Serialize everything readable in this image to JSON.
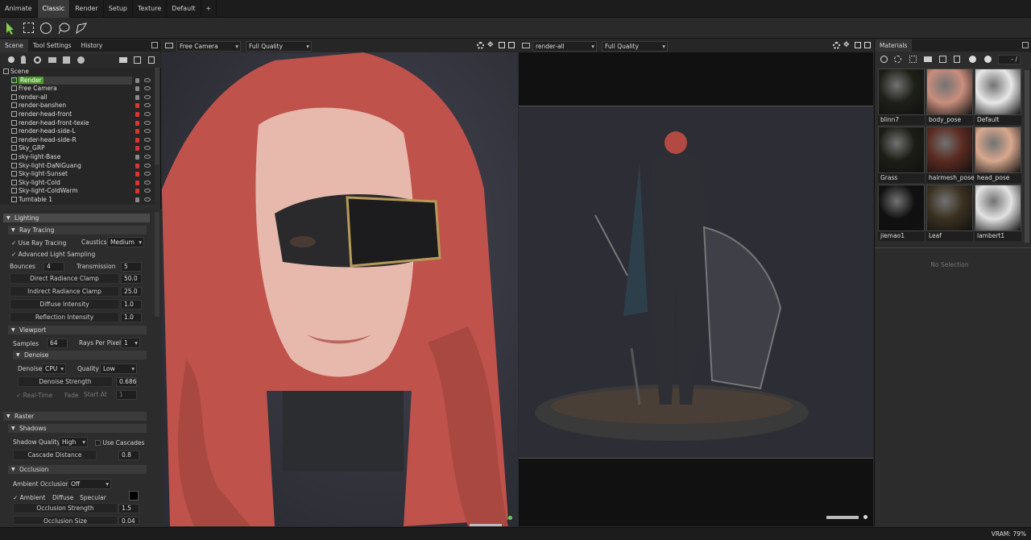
{
  "menu": [
    "Animate",
    "Classic",
    "Render",
    "Setup",
    "Texture",
    "Default",
    "+"
  ],
  "menu_active": "Classic",
  "toolbar_icons": [
    "select-arrow-icon",
    "rect-select-icon",
    "circle-select-icon",
    "lasso-select-icon",
    "poly-select-icon"
  ],
  "left_tabs": [
    "Scene",
    "Tool Settings",
    "History"
  ],
  "tree": [
    {
      "label": "Scene",
      "color": "#ddd"
    },
    {
      "label": "Render",
      "color": "#fff",
      "selected": true
    },
    {
      "label": "Free Camera"
    },
    {
      "label": "render-all"
    },
    {
      "label": "render-banshen"
    },
    {
      "label": "render-head-front"
    },
    {
      "label": "render-head-front-texie"
    },
    {
      "label": "render-head-side-L"
    },
    {
      "label": "render-head-side-R"
    },
    {
      "label": "Sky_GRP"
    },
    {
      "label": "sky-light-Base"
    },
    {
      "label": "Sky-light-DaNiGuang"
    },
    {
      "label": "Sky-light-Sunset"
    },
    {
      "label": "Sky-light-Cold"
    },
    {
      "label": "Sky-light-ColdWarm"
    },
    {
      "label": "Turntable 1"
    }
  ],
  "lighting": {
    "title": "Lighting",
    "ray_tracing": "Ray Tracing",
    "use_ray_tracing": "Use Ray Tracing",
    "caustics_label": "Caustics",
    "caustics_value": "Medium",
    "adv_light": "Advanced Light Sampling",
    "bounces_label": "Bounces",
    "bounces_value": "4",
    "transmission_label": "Transmission",
    "transmission_value": "5",
    "direct_clamp_label": "Direct Radiance Clamp",
    "direct_clamp_value": "50.0",
    "indirect_clamp_label": "Indirect Radiance Clamp",
    "indirect_clamp_value": "25.0",
    "diffuse_label": "Diffuse Intensity",
    "diffuse_value": "1.0",
    "reflection_label": "Reflection Intensity",
    "reflection_value": "1.0",
    "viewport": "Viewport",
    "samples_label": "Samples",
    "samples_value": "64",
    "rpp_label": "Rays Per Pixel",
    "rpp_value": "1",
    "denoise_section": "Denoise",
    "denoise_label": "Denoise",
    "denoise_value": "CPU",
    "quality_label": "Quality",
    "quality_value": "Low",
    "denoise_strength_label": "Denoise Strength",
    "denoise_strength_value": "0.686",
    "realtime": "Real-Time",
    "fade": "Fade",
    "startat_label": "Start At",
    "startat_value": "1",
    "raster": "Raster",
    "shadows": "Shadows",
    "shadow_quality_label": "Shadow Quality",
    "shadow_quality_value": "High",
    "use_cascades": "Use Cascades",
    "cascade_label": "Cascade Distance",
    "cascade_value": "0.8",
    "occlusion": "Occlusion",
    "ao_label": "Ambient Occlusion",
    "ao_value": "Off",
    "ambient": "Ambient",
    "diffuse": "Diffuse",
    "specular": "Specular",
    "occ_strength_label": "Occlusion Strength",
    "occ_strength_value": "1.5",
    "occ_size_label": "Occlusion Size",
    "occ_size_value": "0.04"
  },
  "viewport_left": {
    "camera": "Free Camera",
    "quality": "Full Quality"
  },
  "viewport_right": {
    "camera": "render-all",
    "quality": "Full Quality"
  },
  "materials_tab": "Materials",
  "materials_counter": "- /",
  "materials": [
    {
      "name": "blinn7",
      "color": "#1d1f18"
    },
    {
      "name": "body_pose",
      "color": "#c98e7d"
    },
    {
      "name": "Default",
      "color": "#e8e8e8"
    },
    {
      "name": "Grass",
      "color": "#1b1d15"
    },
    {
      "name": "hairmesh_pose",
      "color": "#5a2a20"
    },
    {
      "name": "head_pose",
      "color": "#d8a88e"
    },
    {
      "name": "jiemao1",
      "color": "#101010"
    },
    {
      "name": "Leaf",
      "color": "#3a3020"
    },
    {
      "name": "lambert1",
      "color": "#e3e3e3"
    }
  ],
  "no_selection": "No Selection",
  "status": {
    "vram": "VRAM: 79%"
  }
}
